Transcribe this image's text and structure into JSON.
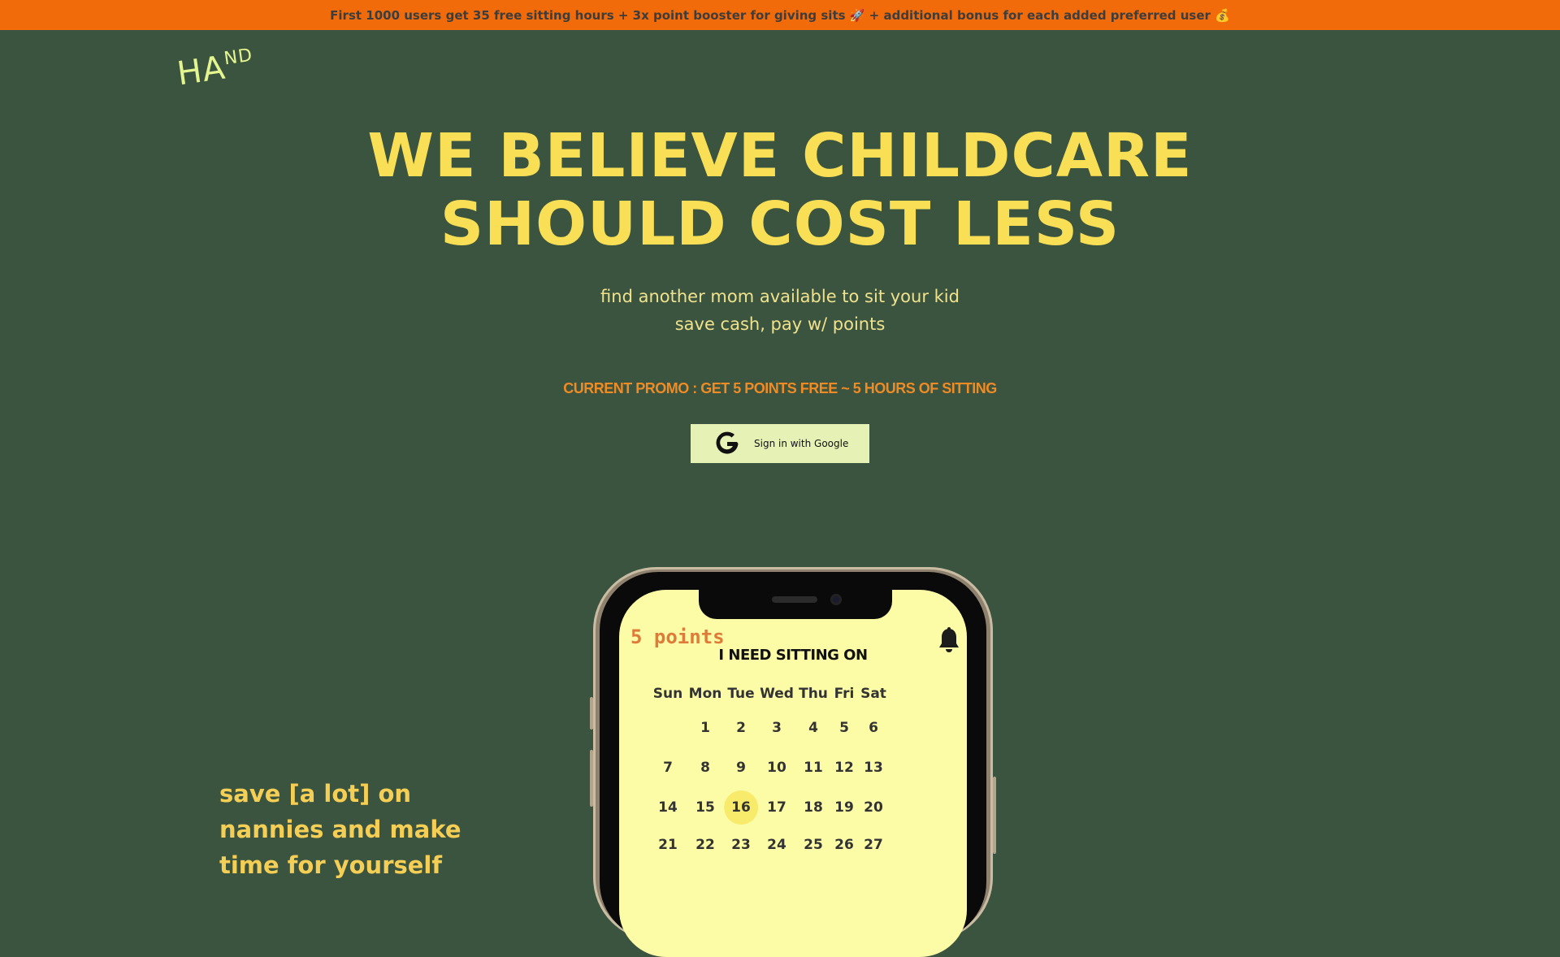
{
  "banner": {
    "text": "First 1000 users get 35 free sitting hours + 3x point booster for giving sits 🚀 + additional bonus for each added preferred user 💰"
  },
  "logo": {
    "main": "HA",
    "small": "ND"
  },
  "hero": {
    "line1": "WE BELIEVE CHILDCARE",
    "line2": "SHOULD COST LESS"
  },
  "subtitle": {
    "line1": "find another mom available to sit your kid",
    "line2": "save cash, pay w/ points"
  },
  "promo": "CURRENT PROMO : GET 5 POINTS FREE ~ 5 HOURS OF SITTING",
  "signin": {
    "label": "Sign in with Google",
    "icon": "google-g-icon"
  },
  "tagline": "save [a lot] on nannies and make time for yourself",
  "phone": {
    "points": "5 points",
    "heading": "I NEED SITTING ON",
    "bell_icon": "bell-icon",
    "weekdays": [
      "Sun",
      "Mon",
      "Tue",
      "Wed",
      "Thu",
      "Fri",
      "Sat"
    ],
    "weeks": [
      [
        "",
        "1",
        "2",
        "3",
        "4",
        "5",
        "6"
      ],
      [
        "7",
        "8",
        "9",
        "10",
        "11",
        "12",
        "13"
      ],
      [
        "14",
        "15",
        "16",
        "17",
        "18",
        "19",
        "20"
      ],
      [
        "21",
        "22",
        "23",
        "24",
        "25",
        "26",
        "27"
      ]
    ],
    "selected_day": "16"
  },
  "colors": {
    "background": "#3b5440",
    "banner": "#f26b0a",
    "headline": "#f9df55",
    "promo": "#ee8b24",
    "screen": "#fdfca6"
  }
}
